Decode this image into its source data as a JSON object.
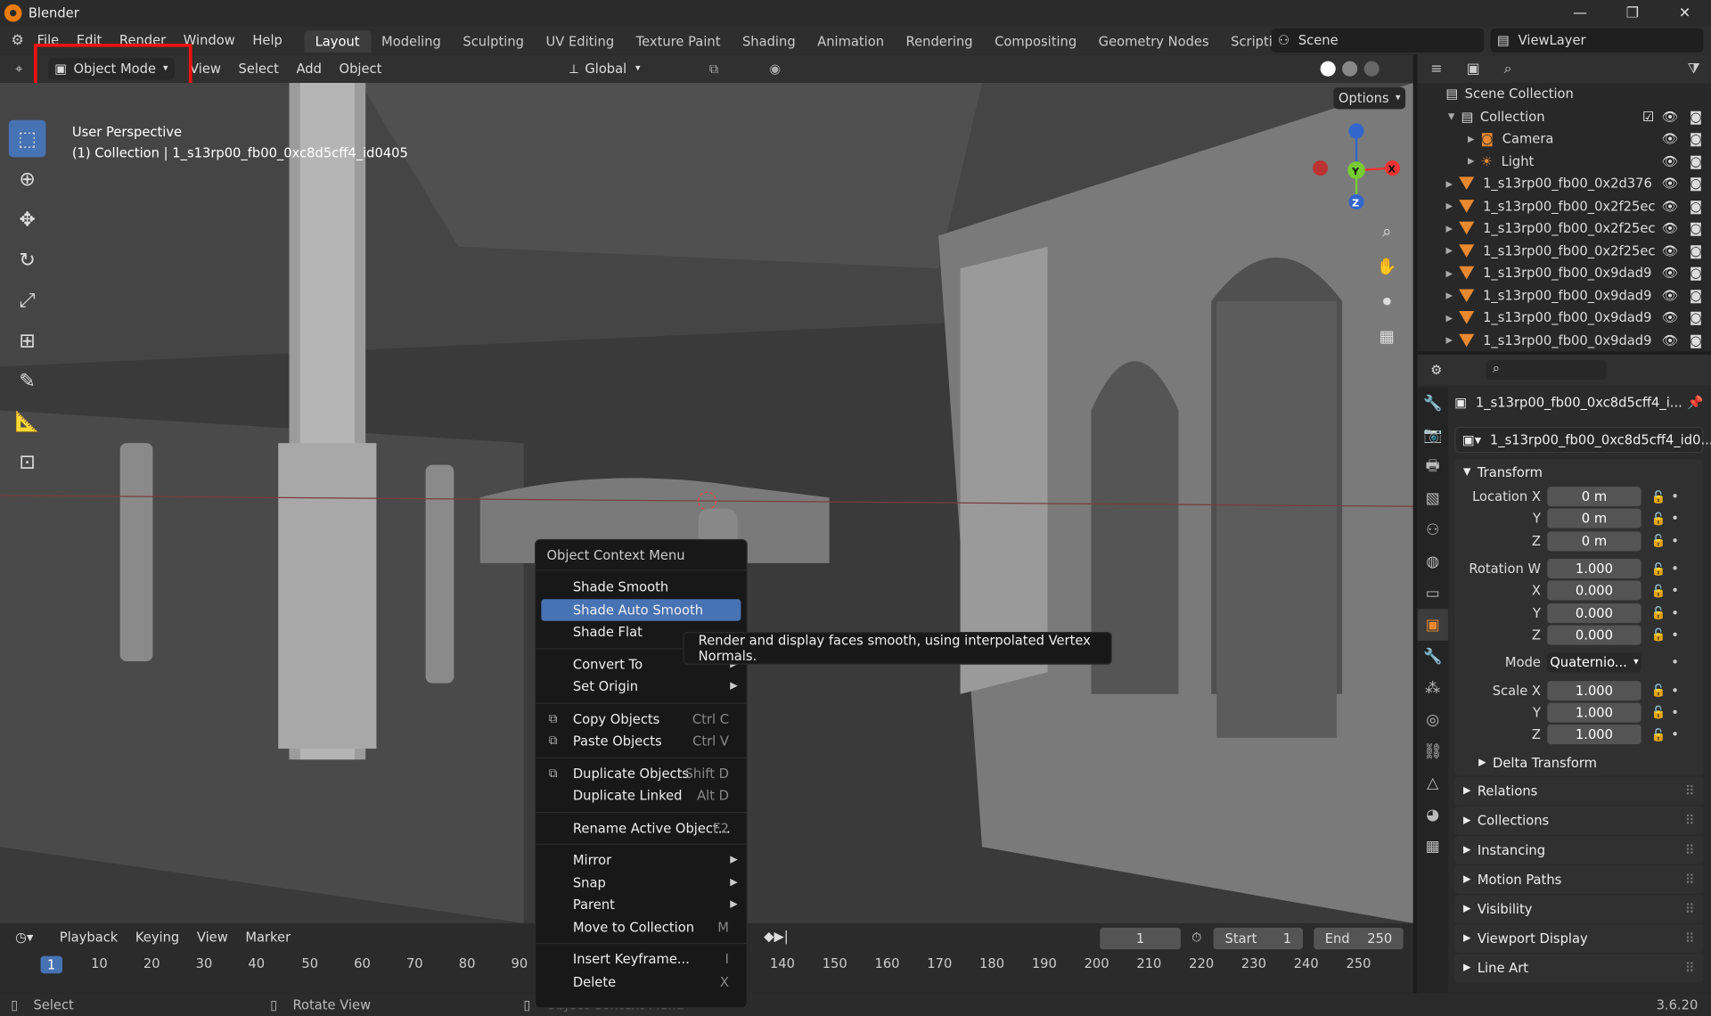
{
  "app": {
    "title": "Blender",
    "version": "3.6.20"
  },
  "menu": [
    "File",
    "Edit",
    "Render",
    "Window",
    "Help"
  ],
  "workspaces": [
    "Layout",
    "Modeling",
    "Sculpting",
    "UV Editing",
    "Texture Paint",
    "Shading",
    "Animation",
    "Rendering",
    "Compositing",
    "Geometry Nodes",
    "Scripting"
  ],
  "active_workspace": "Layout",
  "scene": "Scene",
  "view_layer": "ViewLayer",
  "viewport": {
    "mode": "Object Mode",
    "menus": [
      "View",
      "Select",
      "Add",
      "Object"
    ],
    "transform_orientation": "Global",
    "options": "Options",
    "perspective": "User Perspective",
    "active": "(1) Collection | 1_s13rp00_fb00_0xc8d5cff4_id0405",
    "gizmo": {
      "x": "X",
      "y": "Y",
      "z": "Z"
    }
  },
  "outliner": {
    "root": "Scene Collection",
    "collection": "Collection",
    "items": [
      "Camera",
      "Light",
      "1_s13rp00_fb00_0x2d376",
      "1_s13rp00_fb00_0x2f25ec",
      "1_s13rp00_fb00_0x2f25ec",
      "1_s13rp00_fb00_0x2f25ec",
      "1_s13rp00_fb00_0x9dad9",
      "1_s13rp00_fb00_0x9dad9",
      "1_s13rp00_fb00_0x9dad9",
      "1_s13rp00_fb00_0x9dad9"
    ]
  },
  "properties": {
    "object_name": "1_s13rp00_fb00_0xc8d5cff4_i...",
    "data_name": "1_s13rp00_fb00_0xc8d5cff4_id0...",
    "transform": "Transform",
    "location": {
      "label": "Location X",
      "x": "0 m",
      "y": "0 m",
      "z": "0 m"
    },
    "rotation": {
      "label": "Rotation W",
      "w": "1.000",
      "x": "0.000",
      "y": "0.000",
      "z": "0.000"
    },
    "mode_label": "Mode",
    "mode": "Quaternio...",
    "scale": {
      "label": "Scale X",
      "x": "1.000",
      "y": "1.000",
      "z": "1.000"
    },
    "axis": {
      "y": "Y",
      "z": "Z",
      "x": "X"
    },
    "subpanels": [
      "Delta Transform",
      "Relations",
      "Collections",
      "Instancing",
      "Motion Paths",
      "Visibility",
      "Viewport Display",
      "Line Art"
    ]
  },
  "context_menu": {
    "title": "Object Context Menu",
    "items": [
      {
        "label": "Shade Smooth",
        "shortcut": ""
      },
      {
        "label": "Shade Auto Smooth",
        "shortcut": "",
        "highlight": true
      },
      {
        "label": "Shade Flat",
        "shortcut": ""
      },
      {
        "label": "Convert To",
        "shortcut": "",
        "sub": true
      },
      {
        "label": "Set Origin",
        "shortcut": "",
        "sub": true
      },
      {
        "label": "Copy Objects",
        "shortcut": "Ctrl C"
      },
      {
        "label": "Paste Objects",
        "shortcut": "Ctrl V"
      },
      {
        "label": "Duplicate Objects",
        "shortcut": "Shift D"
      },
      {
        "label": "Duplicate Linked",
        "shortcut": "Alt D"
      },
      {
        "label": "Rename Active Object...",
        "shortcut": "F2"
      },
      {
        "label": "Mirror",
        "sub": true
      },
      {
        "label": "Snap",
        "sub": true
      },
      {
        "label": "Parent",
        "sub": true
      },
      {
        "label": "Move to Collection",
        "shortcut": "M"
      },
      {
        "label": "Insert Keyframe...",
        "shortcut": "I"
      },
      {
        "label": "Delete",
        "shortcut": "X"
      }
    ]
  },
  "tooltip": "Render and display faces smooth, using interpolated Vertex Normals.",
  "timeline": {
    "menus": [
      "Playback",
      "Keying",
      "View",
      "Marker"
    ],
    "current": "1",
    "start_label": "Start",
    "start": "1",
    "end_label": "End",
    "end": "250",
    "ticks": [
      "1",
      "10",
      "20",
      "30",
      "40",
      "50",
      "60",
      "70",
      "80",
      "90",
      "140",
      "150",
      "160",
      "170",
      "180",
      "190",
      "200",
      "210",
      "220",
      "230",
      "240",
      "250"
    ]
  },
  "status": {
    "select": "Select",
    "rotate": "Rotate View",
    "context": "Object Context Menu"
  }
}
